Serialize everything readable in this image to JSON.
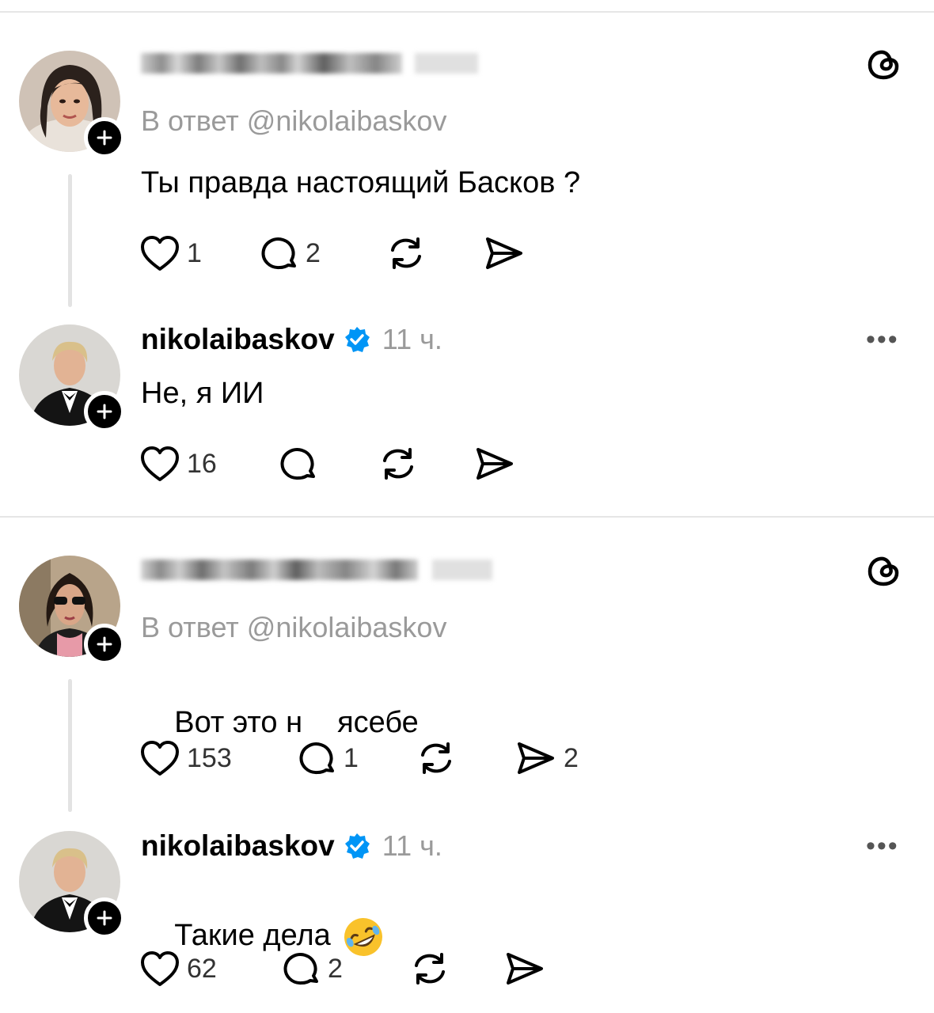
{
  "posts": [
    {
      "reply_to": "В ответ @nikolaibaskov",
      "text": "Ты правда настоящий Басков ?",
      "likes": "1",
      "comments": "2",
      "shares": ""
    },
    {
      "username": "nikolaibaskov",
      "time": "11 ч.",
      "text": "Не, я ИИ",
      "likes": "16",
      "comments": "",
      "shares": ""
    },
    {
      "reply_to": "В ответ @nikolaibaskov",
      "text_part1": "Вот это н",
      "text_part2": "ясебе",
      "likes": "153",
      "comments": "1",
      "shares": "2"
    },
    {
      "username": "nikolaibaskov",
      "time": "11 ч.",
      "text": "Такие дела",
      "likes": "62",
      "comments": "2",
      "shares": ""
    }
  ],
  "colors": {
    "verified": "#0095f6",
    "muted": "#9a9a9a",
    "divider": "#e6e6e6"
  },
  "icons": [
    "threads-logo-icon",
    "heart-icon",
    "comment-icon",
    "repost-icon",
    "share-icon",
    "verified-badge-icon",
    "follow-plus-icon",
    "more-options-icon",
    "rofl-emoji-icon"
  ]
}
